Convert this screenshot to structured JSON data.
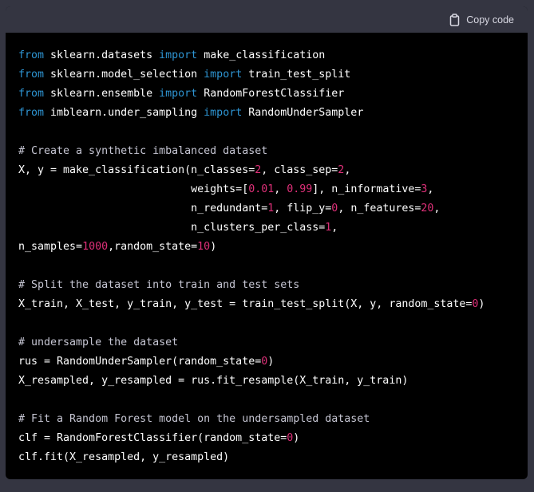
{
  "header": {
    "copy_label": "Copy code",
    "copy_icon": "clipboard-icon"
  },
  "colors": {
    "keyword": "#2e95d3",
    "number": "#df3079",
    "comment": "#c5c5d2",
    "text": "#ffffff",
    "background": "#000000",
    "header": "#343541"
  },
  "code": {
    "language": "python",
    "lines": [
      [
        [
          "kw",
          "from"
        ],
        [
          "tx",
          " sklearn.datasets "
        ],
        [
          "kw",
          "import"
        ],
        [
          "tx",
          " make_classification"
        ]
      ],
      [
        [
          "kw",
          "from"
        ],
        [
          "tx",
          " sklearn.model_selection "
        ],
        [
          "kw",
          "import"
        ],
        [
          "tx",
          " train_test_split"
        ]
      ],
      [
        [
          "kw",
          "from"
        ],
        [
          "tx",
          " sklearn.ensemble "
        ],
        [
          "kw",
          "import"
        ],
        [
          "tx",
          " RandomForestClassifier"
        ]
      ],
      [
        [
          "kw",
          "from"
        ],
        [
          "tx",
          " imblearn.under_sampling "
        ],
        [
          "kw",
          "import"
        ],
        [
          "tx",
          " RandomUnderSampler"
        ]
      ],
      [],
      [
        [
          "cm",
          "# Create a synthetic imbalanced dataset"
        ]
      ],
      [
        [
          "tx",
          "X, y = make_classification(n_classes="
        ],
        [
          "num",
          "2"
        ],
        [
          "tx",
          ", class_sep="
        ],
        [
          "num",
          "2"
        ],
        [
          "tx",
          ","
        ]
      ],
      [
        [
          "tx",
          "                           weights=["
        ],
        [
          "num",
          "0.01"
        ],
        [
          "tx",
          ", "
        ],
        [
          "num",
          "0.99"
        ],
        [
          "tx",
          "], n_informative="
        ],
        [
          "num",
          "3"
        ],
        [
          "tx",
          ","
        ]
      ],
      [
        [
          "tx",
          "                           n_redundant="
        ],
        [
          "num",
          "1"
        ],
        [
          "tx",
          ", flip_y="
        ],
        [
          "num",
          "0"
        ],
        [
          "tx",
          ", n_features="
        ],
        [
          "num",
          "20"
        ],
        [
          "tx",
          ","
        ]
      ],
      [
        [
          "tx",
          "                           n_clusters_per_class="
        ],
        [
          "num",
          "1"
        ],
        [
          "tx",
          ","
        ]
      ],
      [
        [
          "tx",
          "n_samples="
        ],
        [
          "num",
          "1000"
        ],
        [
          "tx",
          ",random_state="
        ],
        [
          "num",
          "10"
        ],
        [
          "tx",
          ")"
        ]
      ],
      [],
      [
        [
          "cm",
          "# Split the dataset into train and test sets"
        ]
      ],
      [
        [
          "tx",
          "X_train, X_test, y_train, y_test = train_test_split(X, y, random_state="
        ],
        [
          "num",
          "0"
        ],
        [
          "tx",
          ")"
        ]
      ],
      [],
      [
        [
          "cm",
          "# undersample the dataset"
        ]
      ],
      [
        [
          "tx",
          "rus = RandomUnderSampler(random_state="
        ],
        [
          "num",
          "0"
        ],
        [
          "tx",
          ")"
        ]
      ],
      [
        [
          "tx",
          "X_resampled, y_resampled = rus.fit_resample(X_train, y_train)"
        ]
      ],
      [],
      [
        [
          "cm",
          "# Fit a Random Forest model on the undersampled dataset"
        ]
      ],
      [
        [
          "tx",
          "clf = RandomForestClassifier(random_state="
        ],
        [
          "num",
          "0"
        ],
        [
          "tx",
          ")"
        ]
      ],
      [
        [
          "tx",
          "clf.fit(X_resampled, y_resampled)"
        ]
      ]
    ]
  }
}
